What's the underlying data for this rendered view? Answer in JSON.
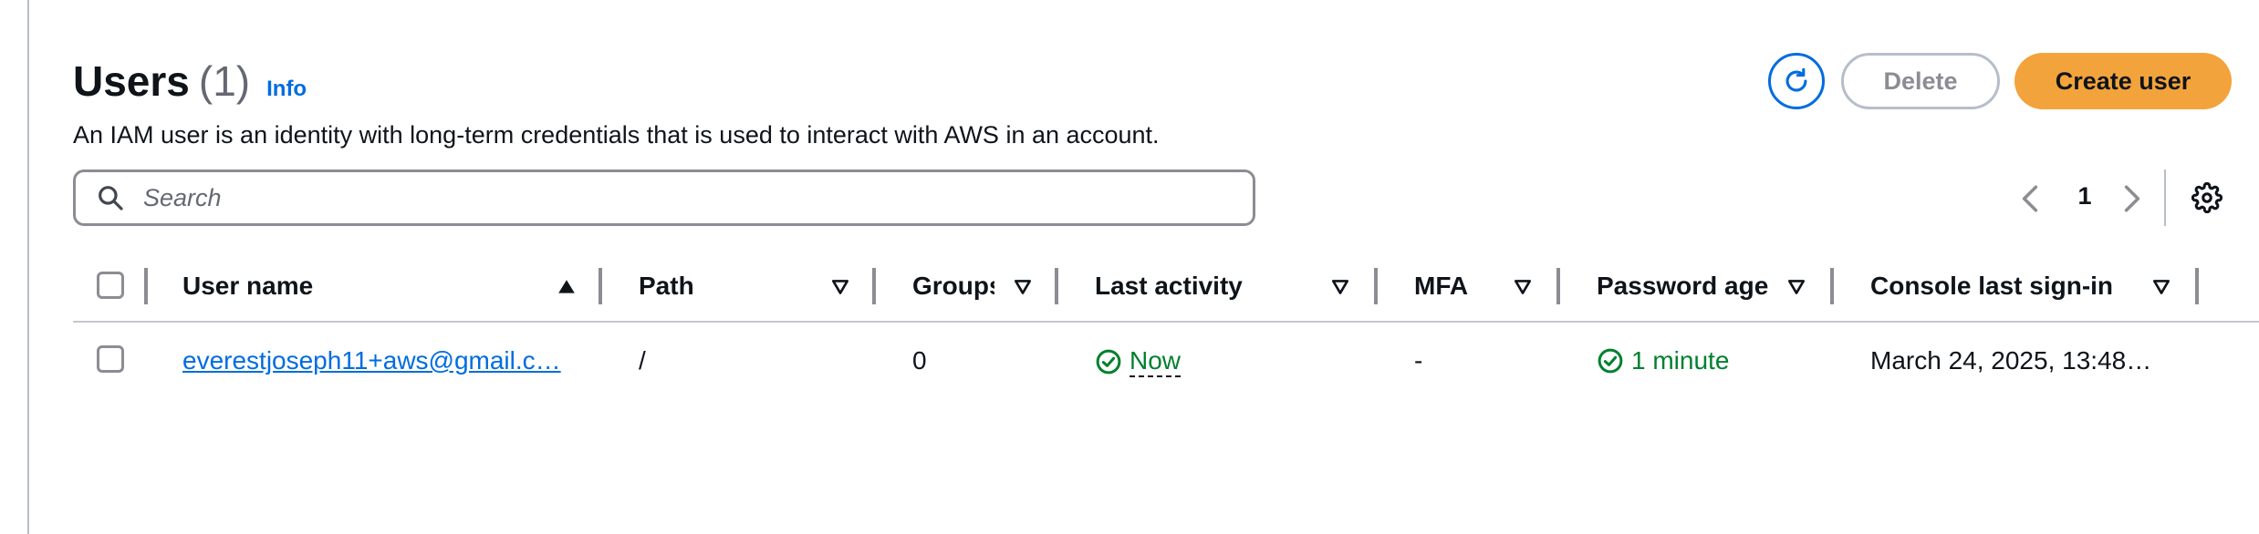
{
  "header": {
    "title": "Users",
    "count": "(1)",
    "info_link": "Info",
    "description": "An IAM user is an identity with long-term credentials that is used to interact with AWS in an account."
  },
  "actions": {
    "refresh_icon": "refresh-icon",
    "delete_label": "Delete",
    "create_label": "Create user"
  },
  "search": {
    "placeholder": "Search",
    "value": ""
  },
  "pagination": {
    "current_page": "1"
  },
  "table": {
    "columns": [
      {
        "label": "User name",
        "sort": "ascending"
      },
      {
        "label": "Path",
        "sort": "none"
      },
      {
        "label": "Groups",
        "sort": "none"
      },
      {
        "label": "Last activity",
        "sort": "none"
      },
      {
        "label": "MFA",
        "sort": "none"
      },
      {
        "label": "Password age",
        "sort": "none"
      },
      {
        "label": "Console last sign-in",
        "sort": "none"
      }
    ],
    "rows": [
      {
        "user_name": "everestjoseph11+aws@gmail.c…",
        "path": "/",
        "groups": "0",
        "last_activity": "Now",
        "mfa": "-",
        "password_age": "1 minute",
        "console_last_sign_in": "March 24, 2025, 13:48…"
      }
    ]
  },
  "colors": {
    "accent": "#006ce0",
    "primary_button": "#f3a33b",
    "success": "#00802f"
  }
}
